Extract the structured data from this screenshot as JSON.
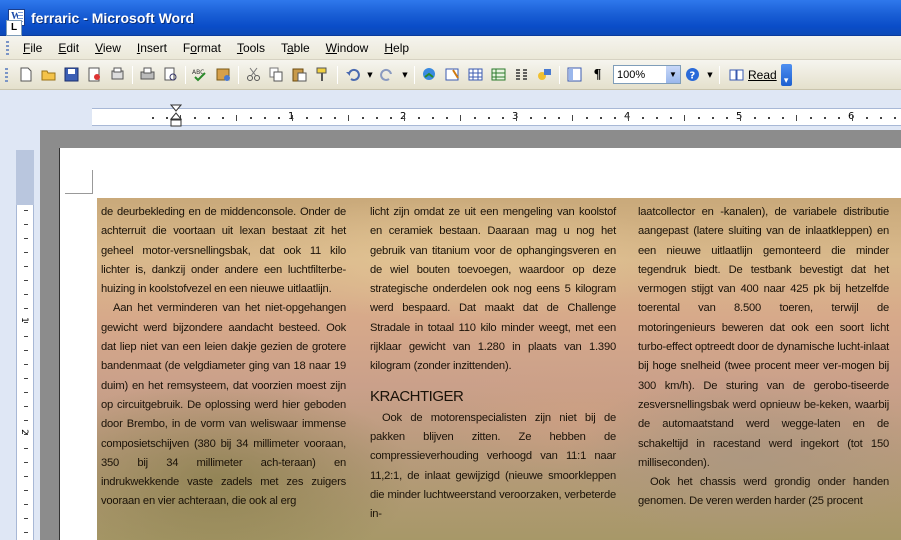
{
  "window": {
    "title": "ferraric - Microsoft Word"
  },
  "menu": {
    "items": [
      {
        "label": "File"
      },
      {
        "label": "Edit"
      },
      {
        "label": "View"
      },
      {
        "label": "Insert"
      },
      {
        "label": "Format"
      },
      {
        "label": "Tools"
      },
      {
        "label": "Table"
      },
      {
        "label": "Window"
      },
      {
        "label": "Help"
      }
    ]
  },
  "toolbar": {
    "zoom": "100%",
    "read_label": "Read",
    "icons": [
      "new-icon",
      "open-icon",
      "save-icon",
      "permission-icon",
      "print-preview-icon",
      "print-icon",
      "research-icon",
      "spelling-icon",
      "research-book-icon",
      "cut-icon",
      "copy-icon",
      "paste-icon",
      "format-painter-icon",
      "undo-icon",
      "redo-icon",
      "hyperlink-icon",
      "tables-borders-icon",
      "insert-table-icon",
      "insert-excel-icon",
      "columns-icon",
      "drawing-icon",
      "document-map-icon",
      "show-hide-icon"
    ],
    "colors": {
      "title_bar": "#0a4dc8",
      "toolbar": "#ece9d8"
    }
  },
  "ruler": {
    "numbers": [
      "1",
      "2",
      "3",
      "4",
      "5",
      "6"
    ]
  },
  "vruler": {
    "numbers": [
      "1",
      "2"
    ]
  },
  "document": {
    "col1": {
      "p1": "de deurbekleding en de middenconsole. Onder de achterruit die voortaan uit lexan bestaat zit het geheel motor-versnellingsbak, dat ook 11 kilo lichter is, dankzij onder andere een luchtfilterbe-huizing in koolstofvezel en een nieuwe uitlaatlijn.",
      "p2": "Aan het verminderen van het niet-opgehangen gewicht werd bijzondere aandacht besteed. Ook dat liep niet van een leien dakje gezien de grotere bandenmaat (de velgdiameter ging van 18 naar 19 duim) en het remsysteem, dat voorzien moest zijn op circuitgebruik. De oplossing werd hier geboden door Brembo, in de vorm van weliswaar immense composietschijven (380 bij 34 millimeter vooraan, 350 bij 34 millimeter ach-teraan) en indrukwekkende vaste zadels met zes zuigers vooraan en vier achteraan, die ook al erg"
    },
    "col2": {
      "p1": "licht zijn omdat ze uit een mengeling van koolstof en ceramiek bestaan. Daaraan mag u nog het gebruik van titanium voor de ophangingsveren en de wiel bouten toevoegen, waardoor op deze strategische onderdelen ook nog eens 5 kilogram werd bespaard. Dat maakt dat de Challenge Stradale in totaal 110 kilo minder weegt, met een rijklaar gewicht van 1.280 in plaats van 1.390 kilogram (zonder inzittenden).",
      "heading": "KRACHTIGER",
      "p2": "Ook de motorenspecialisten zijn niet bij de pakken blijven zitten. Ze hebben de compressieverhouding verhoogd van 11:1 naar 11,2:1, de inlaat gewijzigd (nieuwe smoorkleppen die minder luchtweerstand veroorzaken, verbeterde in-"
    },
    "col3": {
      "p1": "laatcollector en -kanalen), de variabele distributie aangepast (latere sluiting van de inlaatkleppen) en een nieuwe uitlaatlijn gemonteerd die minder tegendruk biedt. De testbank bevestigt dat het vermogen stijgt van 400 naar 425 pk bij hetzelfde toerental van 8.500 toeren, terwijl de motoringenieurs beweren dat ook een soort licht turbo-effect optreedt door de dynamische lucht-inlaat bij hoge snelheid (twee procent meer ver-mogen bij 300 km/h). De sturing van de gerobo-tiseerde zesversnellingsbak werd opnieuw be-keken, waarbij de automaatstand werd wegge-laten en de schakeltijd in racestand werd ingekort (tot 150 milliseconden).",
      "p2": "Ook het chassis werd grondig onder handen genomen. De veren werden harder (25 procent"
    }
  }
}
